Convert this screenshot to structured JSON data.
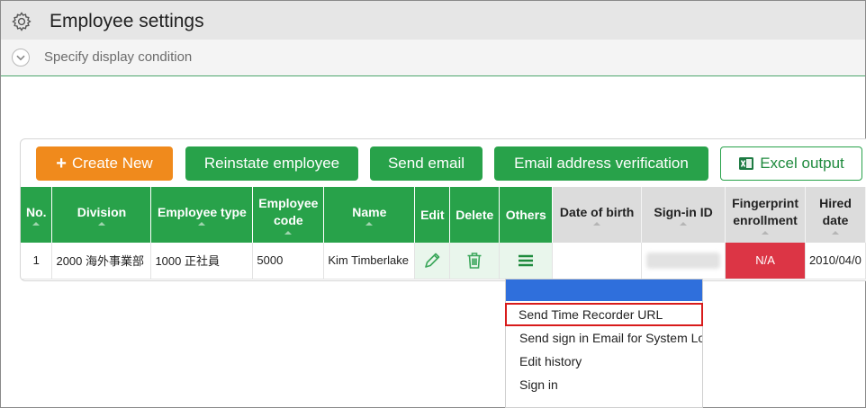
{
  "header": {
    "title": "Employee settings",
    "icon": "gear-icon"
  },
  "condition": {
    "label": "Specify display condition",
    "icon": "chevron-down-icon"
  },
  "toolbar": {
    "create_new": "Create New",
    "reinstate": "Reinstate employee",
    "send_email": "Send email",
    "email_verify": "Email address verification",
    "excel_output": "Excel output"
  },
  "table": {
    "headers": {
      "no": "No.",
      "division": "Division",
      "employee_type": "Employee type",
      "employee_code_1": "Employee",
      "employee_code_2": "code",
      "name": "Name",
      "edit": "Edit",
      "delete": "Delete",
      "others": "Others",
      "date_of_birth": "Date of birth",
      "sign_in_id": "Sign-in ID",
      "fingerprint_1": "Fingerprint",
      "fingerprint_2": "enrollment",
      "hired_1": "Hired",
      "hired_2": "date"
    },
    "rows": [
      {
        "no": "1",
        "division": "2000 海外事業部",
        "employee_type": "1000 正社員",
        "employee_code": "5000",
        "name": "Kim Timberlake",
        "date_of_birth": "",
        "fingerprint": "N/A",
        "hired_date": "2010/04/0"
      }
    ]
  },
  "others_menu": {
    "items": [
      "Send Time Recorder URL",
      "Send sign in Email for System Log",
      "Edit history",
      "Sign in"
    ]
  },
  "colors": {
    "accent_green": "#28a24a",
    "accent_orange": "#f08a1c",
    "danger_red": "#dc3545",
    "menu_blue": "#2f6fdc",
    "highlight_red": "#d81b1b"
  }
}
